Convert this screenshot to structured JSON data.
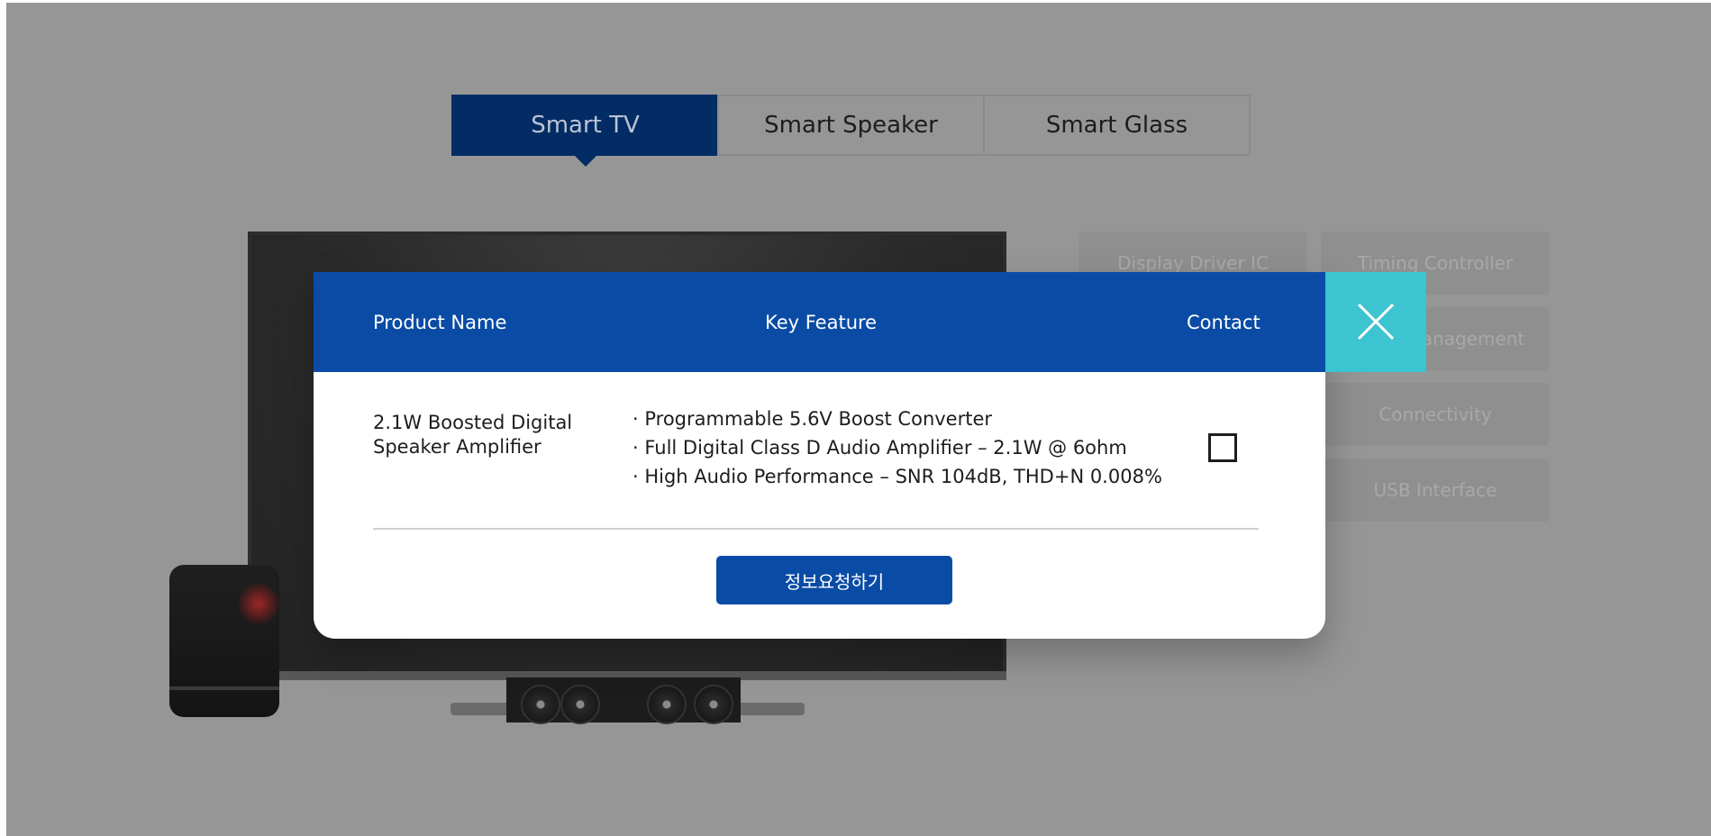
{
  "tabs": [
    {
      "label": "Smart TV",
      "active": true
    },
    {
      "label": "Smart Speaker",
      "active": false
    },
    {
      "label": "Smart Glass",
      "active": false
    }
  ],
  "categories": [
    {
      "label": "Display Driver IC"
    },
    {
      "label": "Timing Controller"
    },
    {
      "label": "Power Management"
    },
    {
      "label": "Connectivity"
    },
    {
      "label": "USB Interface"
    }
  ],
  "modal": {
    "headers": {
      "product_name": "Product Name",
      "key_feature": "Key Feature",
      "contact": "Contact"
    },
    "row": {
      "product_name": "2.1W Boosted Digital Speaker Amplifier",
      "features": [
        "· Programmable 5.6V Boost Converter",
        "· Full Digital Class D Audio Amplifier – 2.1W @ 6ohm",
        "· High Audio Performance – SNR 104dB, THD+N 0.008%"
      ],
      "contact_checked": false
    },
    "request_button": "정보요청하기",
    "close_icon": "close-icon"
  },
  "colors": {
    "overlay": "#969696",
    "tab_active": "#032c64",
    "modal_header": "#0a4ca5",
    "close_button": "#3cc4d0",
    "request_button": "#0a4ca5"
  }
}
